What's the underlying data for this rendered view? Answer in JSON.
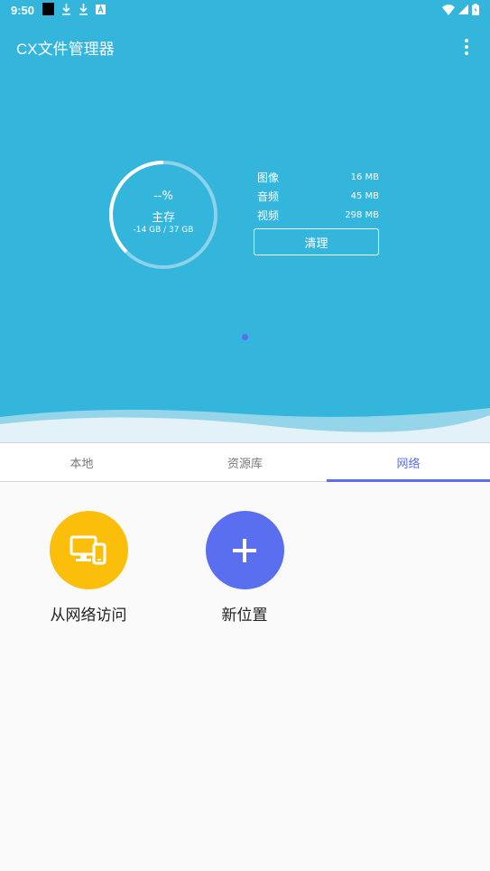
{
  "status_bar": {
    "time": "9:50",
    "left_icons": [
      "app-square-icon",
      "download-icon",
      "download-icon",
      "text-a-icon"
    ],
    "right_icons": [
      "wifi-icon",
      "signal-icon",
      "battery-icon"
    ]
  },
  "app_bar": {
    "title": "CX文件管理器",
    "more_icon": "more-vert-icon"
  },
  "storage": {
    "percent": "--%",
    "label": "主存",
    "usage": "-14 GB / 37 GB",
    "stats": [
      {
        "label": "图像",
        "size": "16 MB"
      },
      {
        "label": "音频",
        "size": "45 MB"
      },
      {
        "label": "视频",
        "size": "298 MB"
      }
    ],
    "clean_label": "清理"
  },
  "tabs": [
    {
      "label": "本地",
      "active": false
    },
    {
      "label": "资源库",
      "active": false
    },
    {
      "label": "网络",
      "active": true
    }
  ],
  "network_actions": [
    {
      "label": "从网络访问",
      "icon": "devices-icon",
      "color": "#fbbf0b"
    },
    {
      "label": "新位置",
      "icon": "plus-icon",
      "color": "#5a6ef0"
    }
  ],
  "colors": {
    "primary": "#33b5dc",
    "accent": "#5a6ef0",
    "background": "#fafafa"
  }
}
